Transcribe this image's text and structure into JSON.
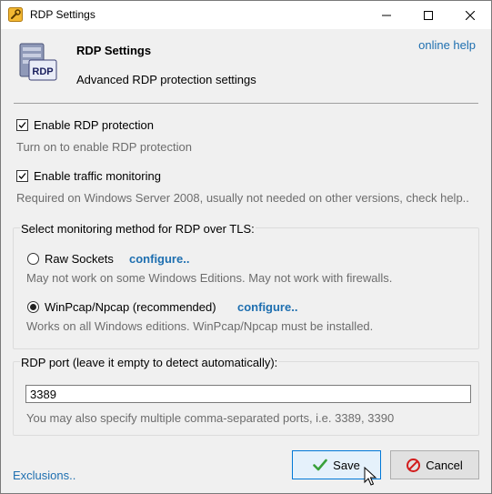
{
  "window": {
    "title": "RDP Settings",
    "app_icon": "wrench-icon",
    "controls": [
      "minimize-icon",
      "maximize-icon",
      "close-icon"
    ]
  },
  "header": {
    "icon": "rdp-server-icon",
    "icon_badge": "RDP",
    "title": "RDP Settings",
    "subtitle": "Advanced RDP protection settings",
    "help_link": "online help"
  },
  "options": {
    "rdp_protection": {
      "label": "Enable RDP protection",
      "checked": true,
      "hint": "Turn on to enable RDP protection"
    },
    "traffic_monitoring": {
      "label": "Enable traffic monitoring",
      "checked": true,
      "hint": "Required on Windows Server 2008, usually not needed on other versions, check help.."
    }
  },
  "monitoring": {
    "group_label": "Select monitoring method for RDP over TLS:",
    "raw_sockets": {
      "label": "Raw Sockets",
      "selected": false,
      "configure": "configure..",
      "hint": "May not work on some Windows Editions. May not work with firewalls."
    },
    "winpcap": {
      "label": "WinPcap/Npcap (recommended)",
      "selected": true,
      "configure": "configure..",
      "hint": "Works on all Windows editions. WinPcap/Npcap must be installed."
    }
  },
  "port": {
    "label": "RDP port (leave it empty to detect automatically):",
    "value": "3389",
    "hint": "You may also specify multiple comma-separated ports, i.e. 3389, 3390"
  },
  "footer": {
    "exclusions": "Exclusions..",
    "save": "Save",
    "cancel": "Cancel"
  },
  "colors": {
    "link": "#1e6fb0",
    "hint": "#6d6d6d",
    "save_border": "#0078d7",
    "save_fill": "#e5f1fb"
  }
}
